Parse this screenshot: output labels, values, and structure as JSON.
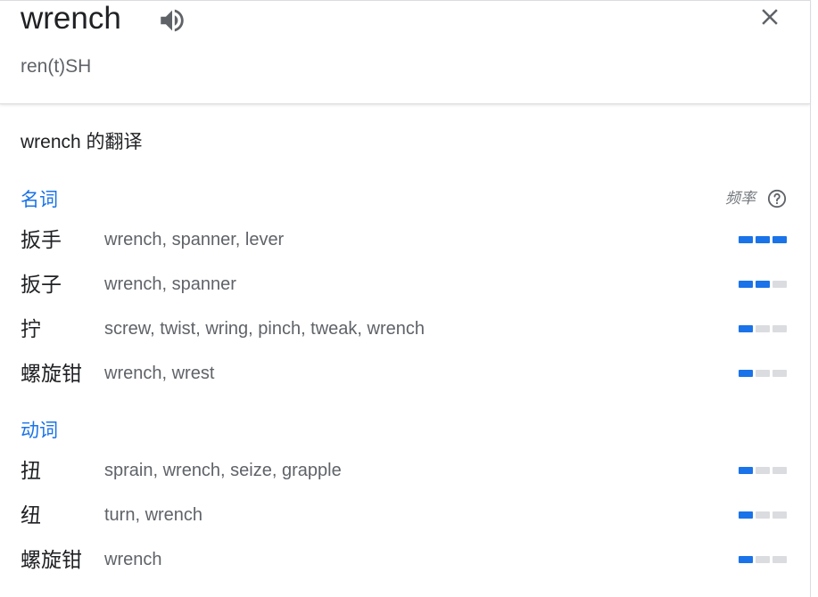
{
  "header": {
    "word": "wrench",
    "phonetic": "ren(t)SH"
  },
  "translations": {
    "title": "wrench 的翻译",
    "frequency_label": "频率",
    "groups": [
      {
        "pos": "名词",
        "rows": [
          {
            "term": "扳手",
            "synonyms": "wrench, spanner, lever",
            "frequency": 3
          },
          {
            "term": "扳子",
            "synonyms": "wrench, spanner",
            "frequency": 2
          },
          {
            "term": "拧",
            "synonyms": "screw, twist, wring, pinch, tweak, wrench",
            "frequency": 1
          },
          {
            "term": "螺旋钳",
            "synonyms": "wrench, wrest",
            "frequency": 1
          }
        ]
      },
      {
        "pos": "动词",
        "rows": [
          {
            "term": "扭",
            "synonyms": "sprain, wrench, seize, grapple",
            "frequency": 1
          },
          {
            "term": "纽",
            "synonyms": "turn, wrench",
            "frequency": 1
          },
          {
            "term": "螺旋钳",
            "synonyms": "wrench",
            "frequency": 1
          }
        ]
      }
    ]
  },
  "colors": {
    "accent": "#1a73e8",
    "bar_off": "#dadce0",
    "text_primary": "#202124",
    "text_secondary": "#5f6368"
  },
  "icons": {
    "speaker": "speaker-icon",
    "close": "close-icon",
    "help": "help-circle-icon"
  }
}
